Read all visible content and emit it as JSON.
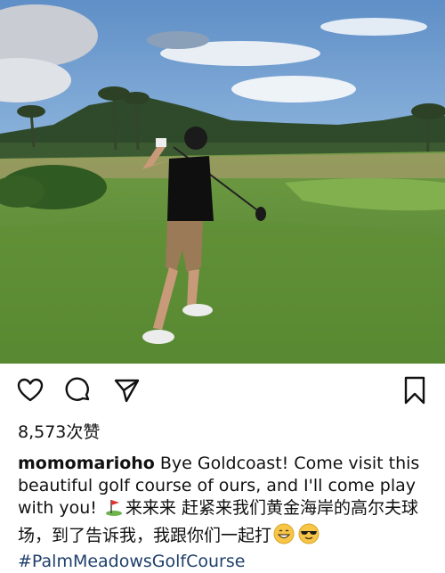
{
  "post": {
    "photo_alt": "",
    "likes_count": "8,573",
    "likes_suffix": "次赞",
    "username": "momomarioho",
    "caption_en": " Bye Goldcoast! Come visit this beautiful golf course of ours, and I'll come play with you! ",
    "caption_zh_1": "来来来 赶紧来我们黄金海岸的高尔夫球场，到了告诉我，我跟你们一起打",
    "hashtag": "#PalmMeadowsGolfCourse"
  },
  "icons": {
    "like": "heart-icon",
    "comment": "comment-icon",
    "share": "send-icon",
    "save": "bookmark-icon",
    "golf": "golf-flag-emoji",
    "grin": "grinning-emoji",
    "cool": "sunglasses-emoji"
  },
  "colors": {
    "hashtag": "#1f3f6b",
    "text": "#111111"
  }
}
